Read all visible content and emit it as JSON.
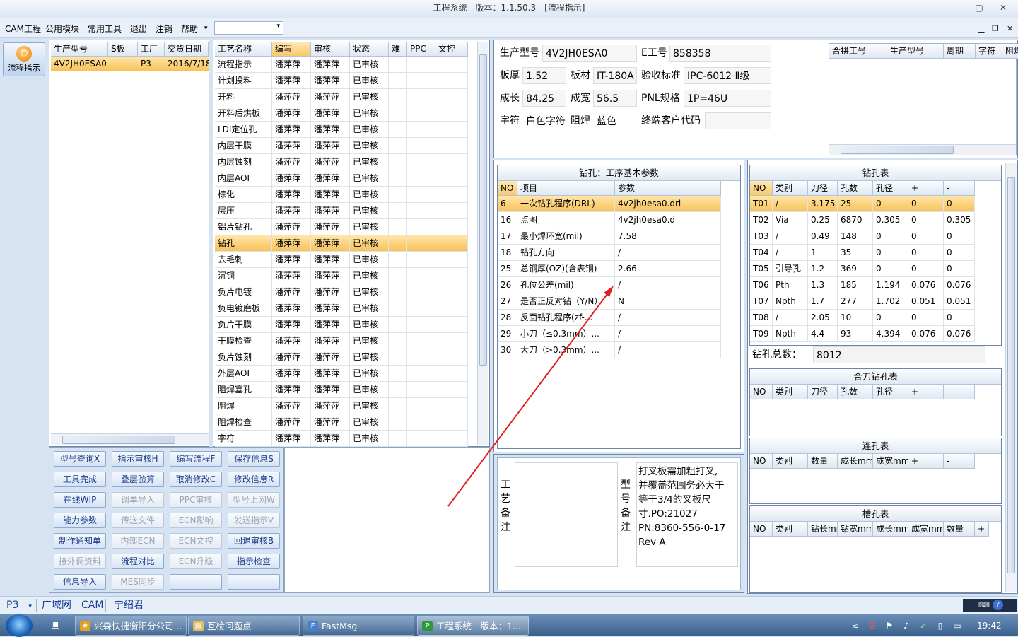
{
  "window": {
    "title": "工程系统　版本：1.1.50.3 - [流程指示]",
    "min": "–",
    "max": "▢",
    "close": "✕"
  },
  "menu": {
    "items": [
      "CAM工程",
      "公用模块",
      "常用工具",
      "退出",
      "注销",
      "帮助"
    ],
    "more": "▾",
    "mdi": [
      "▁",
      "❐",
      "✕"
    ]
  },
  "leftnav": {
    "label": "流程指示",
    "icon": "⏻"
  },
  "orders": {
    "headers": [
      "生产型号",
      "S板",
      "工厂",
      "交货日期"
    ],
    "rows": [
      [
        "4V2JH0ESA0",
        "",
        "P3",
        "2016/7/18"
      ]
    ]
  },
  "flow": {
    "headers": [
      "工艺名称",
      "编写",
      "审核",
      "状态",
      "难",
      "PPC",
      "文控"
    ],
    "rows": [
      [
        "流程指示",
        "潘萍萍",
        "潘萍萍",
        "已审核"
      ],
      [
        "计划投料",
        "潘萍萍",
        "潘萍萍",
        "已审核"
      ],
      [
        "开料",
        "潘萍萍",
        "潘萍萍",
        "已审核"
      ],
      [
        "开料后烘板",
        "潘萍萍",
        "潘萍萍",
        "已审核"
      ],
      [
        "LDI定位孔",
        "潘萍萍",
        "潘萍萍",
        "已审核"
      ],
      [
        "内层干膜",
        "潘萍萍",
        "潘萍萍",
        "已审核"
      ],
      [
        "内层蚀刻",
        "潘萍萍",
        "潘萍萍",
        "已审核"
      ],
      [
        "内层AOI",
        "潘萍萍",
        "潘萍萍",
        "已审核"
      ],
      [
        "棕化",
        "潘萍萍",
        "潘萍萍",
        "已审核"
      ],
      [
        "层压",
        "潘萍萍",
        "潘萍萍",
        "已审核"
      ],
      [
        "铝片钻孔",
        "潘萍萍",
        "潘萍萍",
        "已审核"
      ],
      [
        "钻孔",
        "潘萍萍",
        "潘萍萍",
        "已审核"
      ],
      [
        "去毛刺",
        "潘萍萍",
        "潘萍萍",
        "已审核"
      ],
      [
        "沉铜",
        "潘萍萍",
        "潘萍萍",
        "已审核"
      ],
      [
        "负片电镀",
        "潘萍萍",
        "潘萍萍",
        "已审核"
      ],
      [
        "负电镀磨板",
        "潘萍萍",
        "潘萍萍",
        "已审核"
      ],
      [
        "负片干膜",
        "潘萍萍",
        "潘萍萍",
        "已审核"
      ],
      [
        "干膜检查",
        "潘萍萍",
        "潘萍萍",
        "已审核"
      ],
      [
        "负片蚀刻",
        "潘萍萍",
        "潘萍萍",
        "已审核"
      ],
      [
        "外层AOI",
        "潘萍萍",
        "潘萍萍",
        "已审核"
      ],
      [
        "阻焊塞孔",
        "潘萍萍",
        "潘萍萍",
        "已审核"
      ],
      [
        "阻焊",
        "潘萍萍",
        "潘萍萍",
        "已审核"
      ],
      [
        "阻焊检查",
        "潘萍萍",
        "潘萍萍",
        "已审核"
      ],
      [
        "字符",
        "潘萍萍",
        "潘萍萍",
        "已审核"
      ]
    ],
    "selected_index": 11
  },
  "buttons": [
    [
      "型号查询X",
      "指示审核H",
      "编写流程F",
      "保存信息S"
    ],
    [
      "工具完成",
      "叠层验算",
      "取消修改C",
      "修改信息R"
    ],
    [
      "在线WIP",
      "调单导入",
      "PPC审核",
      "型号上网W"
    ],
    [
      "能力参数",
      "传送文件",
      "ECN影响",
      "发送指示V"
    ],
    [
      "制作通知单",
      "内部ECN",
      "ECN文控",
      "回退审核B"
    ],
    [
      "接外调资料",
      "流程对比",
      "ECN升级",
      "指示检查"
    ],
    [
      "信息导入",
      "MES同步",
      "",
      ""
    ]
  ],
  "buttons_disabled": [
    [
      0,
      0,
      0,
      0
    ],
    [
      0,
      0,
      0,
      0
    ],
    [
      0,
      1,
      1,
      1
    ],
    [
      0,
      1,
      1,
      1
    ],
    [
      0,
      1,
      1,
      0
    ],
    [
      1,
      0,
      1,
      0
    ],
    [
      0,
      1,
      0,
      0
    ]
  ],
  "info": {
    "prod_model_label": "生产型号",
    "prod_model": "4V2JH0ESA0",
    "e_no_label": "E工号",
    "e_no": "858358",
    "thick_label": "板厚",
    "thick": "1.52",
    "material_label": "板材",
    "material": "IT-180A",
    "accept_label": "验收标准",
    "accept": "IPC-6012 Ⅱ级",
    "len_label": "成长",
    "len": "84.25",
    "width_label": "成宽",
    "width": "56.5",
    "pnl_label": "PNL规格",
    "pnl": "1P=46U",
    "char_label": "字符",
    "char": "白色字符",
    "mask_label": "阻焊",
    "mask": "蓝色",
    "cust_label": "终端客户代码",
    "cust": ""
  },
  "combine": {
    "headers": [
      "合拼工号",
      "生产型号",
      "周期",
      "字符",
      "阻焊"
    ]
  },
  "drill_params": {
    "title": "钻孔：工序基本参数",
    "headers": [
      "NO",
      "项目",
      "参数"
    ],
    "rows": [
      [
        "6",
        "一次钻孔程序(DRL)",
        "4v2jh0esa0.drl"
      ],
      [
        "16",
        "点图",
        "4v2jh0esa0.d"
      ],
      [
        "17",
        "最小焊环宽(mil)",
        "7.58"
      ],
      [
        "18",
        "钻孔方向",
        "/"
      ],
      [
        "25",
        "总铜厚(OZ)(含表铜)",
        "2.66"
      ],
      [
        "26",
        "孔位公差(mil)",
        "/"
      ],
      [
        "27",
        "是否正反对钻（Y/N）",
        "N"
      ],
      [
        "28",
        "反面钻孔程序(zf-...",
        "/"
      ],
      [
        "29",
        "小刀（≤0.3mm）...",
        "/"
      ],
      [
        "30",
        "大刀（>0.3mm）...",
        "/"
      ]
    ]
  },
  "drill_table": {
    "title": "钻孔表",
    "headers": [
      "NO",
      "类别",
      "刀径",
      "孔数",
      "孔径",
      "+",
      "-"
    ],
    "rows": [
      [
        "T01",
        "/",
        "3.175",
        "25",
        "0",
        "0",
        "0"
      ],
      [
        "T02",
        "Via",
        "0.25",
        "6870",
        "0.305",
        "0",
        "0.305"
      ],
      [
        "T03",
        "/",
        "0.49",
        "148",
        "0",
        "0",
        "0"
      ],
      [
        "T04",
        "/",
        "1",
        "35",
        "0",
        "0",
        "0"
      ],
      [
        "T05",
        "引导孔",
        "1.2",
        "369",
        "0",
        "0",
        "0"
      ],
      [
        "T06",
        "Pth",
        "1.3",
        "185",
        "1.194",
        "0.076",
        "0.076"
      ],
      [
        "T07",
        "Npth",
        "1.7",
        "277",
        "1.702",
        "0.051",
        "0.051"
      ],
      [
        "T08",
        "/",
        "2.05",
        "10",
        "0",
        "0",
        "0"
      ],
      [
        "T09",
        "Npth",
        "4.4",
        "93",
        "4.394",
        "0.076",
        "0.076"
      ]
    ],
    "total_label": "钻孔总数：",
    "total": "8012"
  },
  "combo_drill": {
    "title": "合刀钻孔表",
    "headers": [
      "NO",
      "类别",
      "刀径",
      "孔数",
      "孔径",
      "+",
      "-"
    ]
  },
  "link_hole": {
    "title": "连孔表",
    "headers": [
      "NO",
      "类别",
      "数量",
      "成长mm",
      "成宽mm",
      "+",
      "-"
    ]
  },
  "slot": {
    "title": "槽孔表",
    "headers": [
      "NO",
      "类别",
      "钻长mm",
      "钻宽mm",
      "成长mm",
      "成宽mm",
      "数量",
      "+"
    ]
  },
  "remarks": {
    "process_label": "工艺备注",
    "process": "",
    "model_label": "型号备注",
    "model": "打叉板需加粗打叉,并覆盖范围务必大于等于3/4的叉板尺寸.PO:21027 PN:8360-556-0-17 Rev A"
  },
  "status": {
    "site": "P3",
    "items": [
      "广域网",
      "CAM",
      "宁绍君"
    ]
  },
  "taskbar": {
    "items": [
      "兴森快捷衡阳分公司...",
      "互检问题点",
      "FastMsg",
      "工程系统　版本：1...."
    ],
    "time": "19:42"
  }
}
